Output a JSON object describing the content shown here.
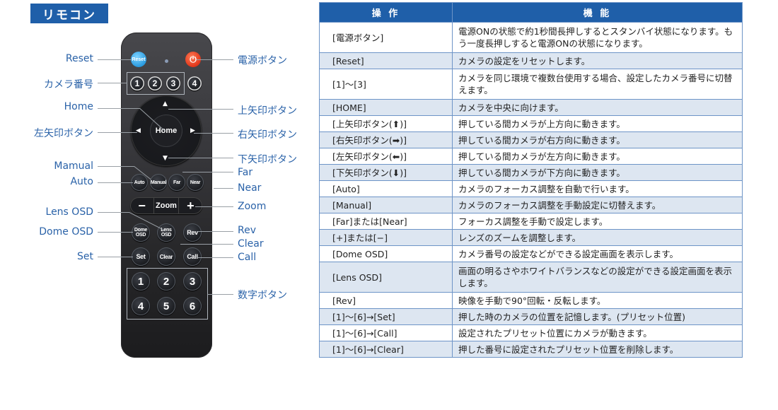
{
  "title": "リモコン",
  "remote": {
    "buttons": {
      "reset": "Reset",
      "power": "⏻",
      "camera_numbers": [
        "1",
        "2",
        "3",
        "4"
      ],
      "home": "Home",
      "arrows": {
        "up": "▲",
        "down": "▼",
        "left": "◀",
        "right": "▶"
      },
      "focus": [
        "Auto",
        "Manual",
        "Far",
        "Near"
      ],
      "zoom": {
        "minus": "−",
        "label": "Zoom",
        "plus": "+"
      },
      "osd_row": [
        "Dome OSD",
        "Lens OSD",
        "Rev"
      ],
      "preset_row": [
        "Set",
        "Clear",
        "Call"
      ],
      "numbers": [
        "1",
        "2",
        "3",
        "4",
        "5",
        "6"
      ]
    },
    "callouts_left": {
      "reset": "Reset",
      "camera_number": "カメラ番号",
      "home": "Home",
      "left_arrow": "左矢印ボタン",
      "manual": "Mamual",
      "auto": "Auto",
      "lens_osd": "Lens OSD",
      "dome_osd": "Dome OSD",
      "set": "Set"
    },
    "callouts_right": {
      "power": "電源ボタン",
      "up_arrow": "上矢印ボタン",
      "right_arrow": "右矢印ボタン",
      "down_arrow": "下矢印ボタン",
      "far": "Far",
      "near": "Near",
      "zoom": "Zoom",
      "rev": "Rev",
      "clear": "Clear",
      "call": "Call",
      "numbers": "数字ボタン"
    }
  },
  "table": {
    "headers": [
      "操 作",
      "機 能"
    ],
    "rows": [
      {
        "op": "[電源ボタン]",
        "fn": "電源ONの状態で約1秒間長押しするとスタンバイ状態になります。もう一度長押しすると電源ONの状態になります。"
      },
      {
        "op": "[Reset]",
        "fn": "カメラの設定をリセットします。"
      },
      {
        "op": "[1]～[3]",
        "fn": "カメラを同じ環境で複数台使用する場合、設定したカメラ番号に切替えます。"
      },
      {
        "op": "[HOME]",
        "fn": "カメラを中央に向けます。"
      },
      {
        "op": "[上矢印ボタン(⬆)]",
        "fn": "押している間カメラが上方向に動きます。"
      },
      {
        "op": "[右矢印ボタン(➡)]",
        "fn": "押している間カメラが右方向に動きます。"
      },
      {
        "op": "[左矢印ボタン(⬅)]",
        "fn": "押している間カメラが左方向に動きます。"
      },
      {
        "op": "[下矢印ボタン(⬇)]",
        "fn": "押している間カメラが下方向に動きます。"
      },
      {
        "op": "[Auto]",
        "fn": "カメラのフォーカス調整を自動で行います。"
      },
      {
        "op": "[Manual]",
        "fn": "カメラのフォーカス調整を手動設定に切替えます。"
      },
      {
        "op": "[Far]または[Near]",
        "fn": "フォーカス調整を手動で設定します。"
      },
      {
        "op": "[+]または[−]",
        "fn": "レンズのズームを調整します。"
      },
      {
        "op": "[Dome OSD]",
        "fn": "カメラ番号の設定などができる設定画面を表示します。"
      },
      {
        "op": "[Lens OSD]",
        "fn": "画面の明るさやホワイトバランスなどの設定ができる設定画面を表示します。"
      },
      {
        "op": "[Rev]",
        "fn": "映像を手動で90°回転・反転します。"
      },
      {
        "op": "[1]～[6]→[Set]",
        "fn": "押した時のカメラの位置を記憶します。(プリセット位置)"
      },
      {
        "op": "[1]～[6]→[Call]",
        "fn": "設定されたプリセット位置にカメラが動きます。"
      },
      {
        "op": "[1]～[6]→[Clear]",
        "fn": "押した番号に設定されたプリセット位置を削除します。"
      }
    ]
  },
  "colors": {
    "accent": "#1f5fa9",
    "label": "#2a62a8",
    "row_alt": "#dde6f1",
    "reset_button": "#2a9be0",
    "power_button": "#e0361a"
  }
}
